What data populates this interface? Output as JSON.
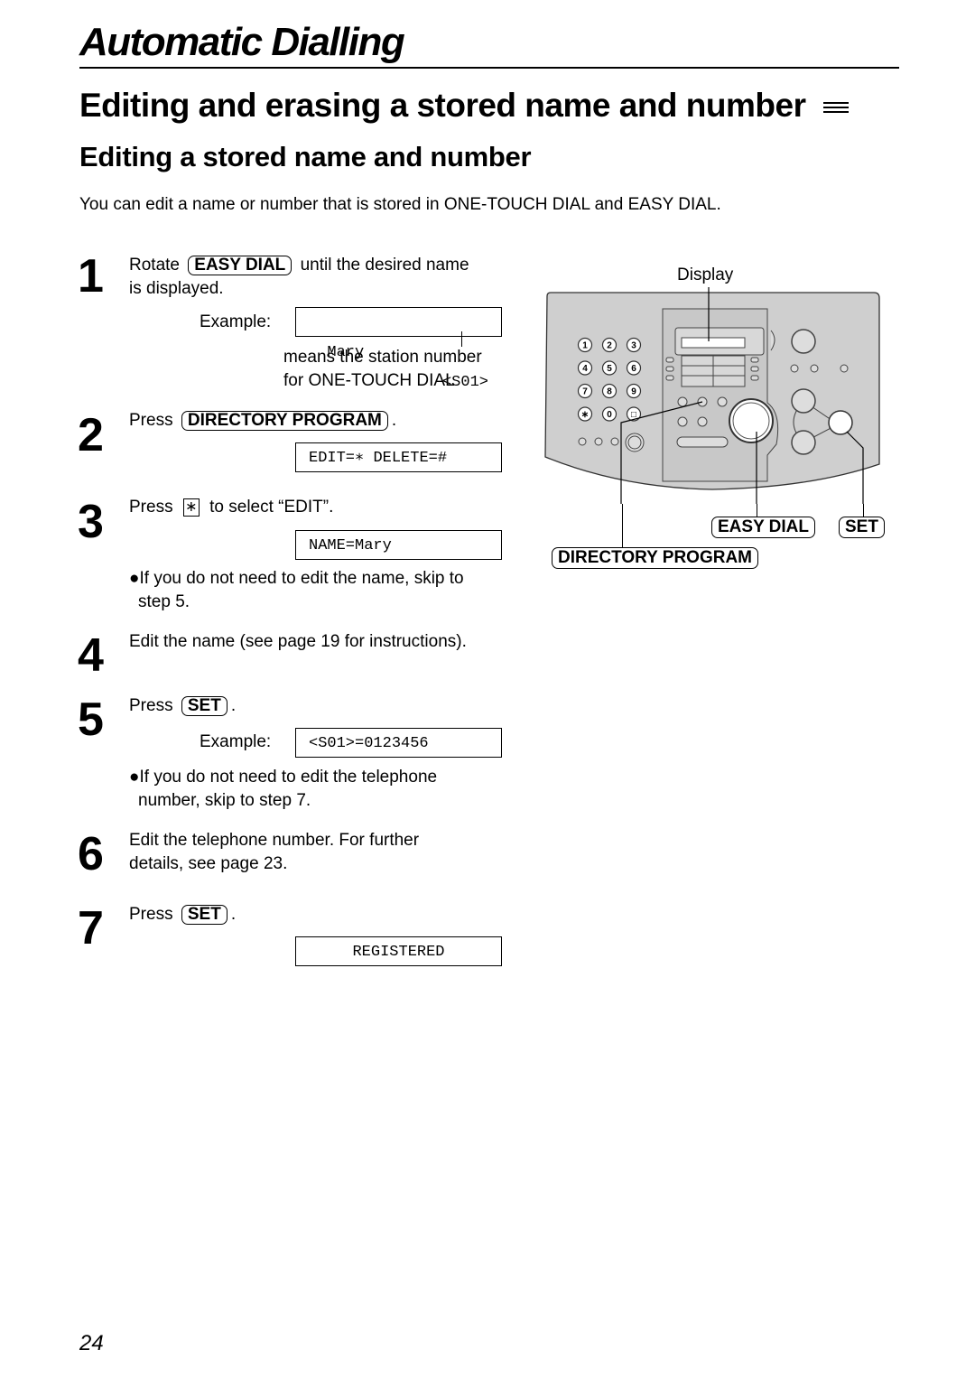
{
  "chapter_title": "Automatic Dialling",
  "section_title": "Editing and erasing a stored name and number",
  "section_icon": "fax-mode-icon",
  "subsection_title": "Editing a stored name and number",
  "intro": "You can edit a name or number that is stored in ONE-TOUCH DIAL and EASY DIAL.",
  "steps": [
    {
      "number": "1",
      "line1_pre": "Rotate",
      "key": "EASY DIAL",
      "line1_post": "until the desired name",
      "line2": "is displayed.",
      "example_label": "Example:",
      "display_left": "Mary",
      "display_right": "<S01>",
      "callout_line1": "means the station number",
      "callout_line2": "for ONE-TOUCH DIAL"
    },
    {
      "number": "2",
      "pre": "Press",
      "key": "DIRECTORY PROGRAM",
      "post": ".",
      "display": "EDIT=∗ DELETE=#"
    },
    {
      "number": "3",
      "pre": "Press",
      "key": "∗",
      "post": "to select “EDIT”.",
      "display": "NAME=Mary",
      "note_line1": "●If you do not need to edit the name, skip to",
      "note_line2": "step 5."
    },
    {
      "number": "4",
      "text": "Edit the name (see page 19 for instructions)."
    },
    {
      "number": "5",
      "pre": "Press",
      "key": "SET",
      "post": ".",
      "example_label": "Example:",
      "display": "<S01>=0123456",
      "note_line1": "●If you do not need to edit the telephone",
      "note_line2": "number, skip to step 7."
    },
    {
      "number": "6",
      "line1": "Edit the telephone number. For further",
      "line2": "details, see page 23."
    },
    {
      "number": "7",
      "pre": "Press",
      "key": "SET",
      "post": ".",
      "display": "REGISTERED"
    }
  ],
  "device": {
    "display_label": "Display",
    "keypad": [
      "1",
      "2",
      "3",
      "4",
      "5",
      "6",
      "7",
      "8",
      "9",
      "∗",
      "0",
      "□"
    ],
    "callouts": {
      "easy_dial": "EASY DIAL",
      "set": "SET",
      "directory_program": "DIRECTORY PROGRAM"
    },
    "panel_color": "#cfcfcf"
  },
  "page_number": "24"
}
